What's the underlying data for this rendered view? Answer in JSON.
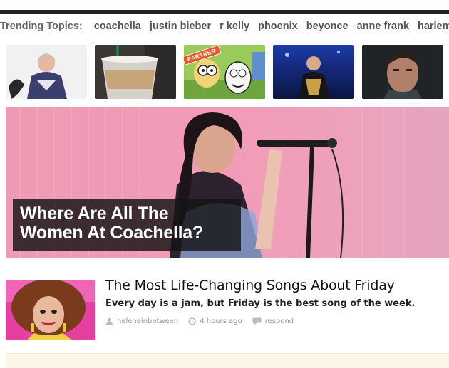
{
  "trending": {
    "label": "Trending Topics:",
    "topics": [
      "coachella",
      "justin bieber",
      "r kelly",
      "phoenix",
      "beyonce",
      "anne frank",
      "harlem"
    ]
  },
  "thumbnails": {
    "partner_badge": "PARTNER"
  },
  "hero": {
    "title_line1": "Where Are All The",
    "title_line2": "Women At Coachella?"
  },
  "article": {
    "title": "The Most Life-Changing Songs About Friday",
    "description": "Every day is a jam, but Friday is the best song of the week.",
    "author": "heleneinbetween",
    "time": "4 hours ago",
    "respond": "respond"
  },
  "colors": {
    "partner": "#e85a28",
    "hero_bg": "#f2a3bd",
    "bottom_strip": "#fdf6e6"
  }
}
